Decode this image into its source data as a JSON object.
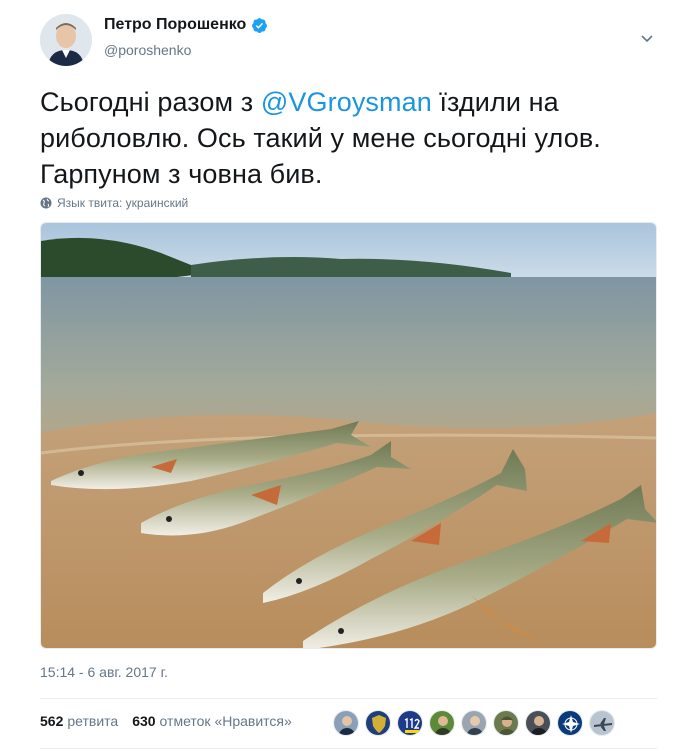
{
  "user": {
    "name": "Петро Порошенко",
    "handle": "@poroshenko"
  },
  "tweet": {
    "text_before": "Сьогодні разом з ",
    "mention": "@VGroysman",
    "text_after": " їздили на риболовлю. Ось такий у мене сьогодні улов. Гарпуном з човна бив.",
    "language_label": "Язык твита: украинский",
    "timestamp": "15:14 - 6 авг. 2017 г.",
    "media_description_icon": "photo-fish-on-beach"
  },
  "stats": {
    "retweets_count": "562",
    "retweets_label": "ретвита",
    "likes_count": "630",
    "likes_label": "отметок «Нравится»"
  },
  "likers": [
    {
      "icon": "avatar-man-suit",
      "color": "#8aa0b8"
    },
    {
      "icon": "avatar-emblem-shield",
      "color": "#1f3f7a"
    },
    {
      "icon": "avatar-112-ua",
      "color": "#1e3a8a"
    },
    {
      "icon": "avatar-man-green",
      "color": "#5b8a3a"
    },
    {
      "icon": "avatar-man-grey",
      "color": "#9aa5b1"
    },
    {
      "icon": "avatar-soldier",
      "color": "#6b7a4f"
    },
    {
      "icon": "avatar-man-dark",
      "color": "#4a4f57"
    },
    {
      "icon": "avatar-nato-star",
      "color": "#0b3a7a"
    },
    {
      "icon": "avatar-aircraft",
      "color": "#b8c4cf"
    }
  ],
  "colors": {
    "accent": "#1b95e0",
    "verified": "#1da1f2",
    "muted": "#657786"
  }
}
